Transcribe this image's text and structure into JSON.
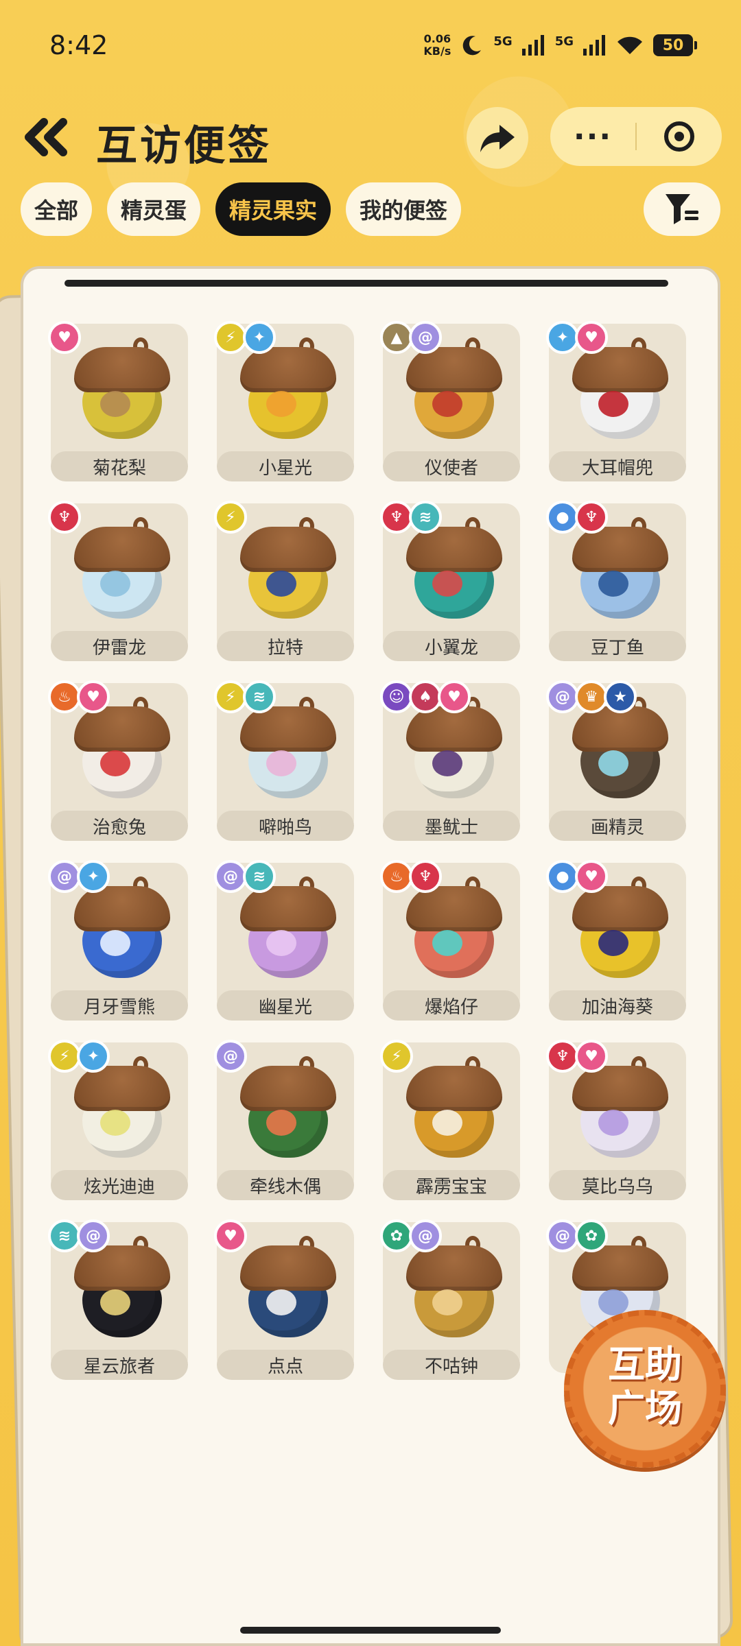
{
  "status": {
    "time": "8:42",
    "net_speed_value": "0.06",
    "net_speed_unit": "KB/s",
    "signal1": "5G",
    "signal2": "5G",
    "battery": "50"
  },
  "header": {
    "title": "互访便签",
    "more_label": "···"
  },
  "tabs": [
    {
      "label": "全部",
      "active": false
    },
    {
      "label": "精灵蛋",
      "active": false
    },
    {
      "label": "精灵果实",
      "active": true
    },
    {
      "label": "我的便签",
      "active": false
    }
  ],
  "items": [
    {
      "name": "菊花梨",
      "body": "#d8c13a",
      "spot": "#b58b52",
      "badges": [
        [
          "heart-icon",
          "#e8578a",
          "♥"
        ]
      ]
    },
    {
      "name": "小星光",
      "body": "#e6c22d",
      "spot": "#f0a030",
      "badges": [
        [
          "bolt-icon",
          "#e0c62c",
          "⚡"
        ],
        [
          "flake-icon",
          "#4aa6e3",
          "✦"
        ]
      ]
    },
    {
      "name": "仪使者",
      "body": "#e0a83a",
      "spot": "#c23a2c",
      "badges": [
        [
          "mountain-icon",
          "#9a8557",
          "▲"
        ],
        [
          "spiral-icon",
          "#9f8fe0",
          "@"
        ]
      ]
    },
    {
      "name": "大耳帽兜",
      "body": "#f1f1f1",
      "spot": "#c0202a",
      "badges": [
        [
          "flake-icon",
          "#4aa6e3",
          "✦"
        ],
        [
          "heart-icon",
          "#e8578a",
          "♥"
        ]
      ]
    },
    {
      "name": "伊雷龙",
      "body": "#cde6f2",
      "spot": "#8fc2df",
      "badges": [
        [
          "dragon-icon",
          "#d8354b",
          "♆"
        ]
      ]
    },
    {
      "name": "拉特",
      "body": "#e8c43a",
      "spot": "#2c4a9a",
      "badges": [
        [
          "bolt-icon",
          "#e0c62c",
          "⚡"
        ]
      ]
    },
    {
      "name": "小翼龙",
      "body": "#2fa69a",
      "spot": "#d84a4a",
      "badges": [
        [
          "dragon-icon",
          "#d8354b",
          "♆"
        ],
        [
          "wing-icon",
          "#47b7b9",
          "≋"
        ]
      ]
    },
    {
      "name": "豆丁鱼",
      "body": "#9cc0e6",
      "spot": "#2c5a9a",
      "badges": [
        [
          "drop-icon",
          "#4a8fe0",
          "●"
        ],
        [
          "dragon-icon",
          "#d8354b",
          "♆"
        ]
      ]
    },
    {
      "name": "治愈兔",
      "body": "#f2ede6",
      "spot": "#d8373a",
      "badges": [
        [
          "fire-icon",
          "#e86a2a",
          "♨"
        ],
        [
          "heart-icon",
          "#e8578a",
          "♥"
        ]
      ]
    },
    {
      "name": "噼啪鸟",
      "body": "#d4e6ec",
      "spot": "#e9b4d8",
      "badges": [
        [
          "bolt-icon",
          "#e0c62c",
          "⚡"
        ],
        [
          "wing-icon",
          "#47b7b9",
          "≋"
        ]
      ]
    },
    {
      "name": "墨鱿士",
      "body": "#efebdc",
      "spot": "#5a3a7a",
      "badges": [
        [
          "ghost-icon",
          "#7a4ac0",
          "☺"
        ],
        [
          "demon-icon",
          "#c43a5a",
          "♠"
        ],
        [
          "heart-icon",
          "#e8578a",
          "♥"
        ]
      ]
    },
    {
      "name": "画精灵",
      "body": "#5a4a3a",
      "spot": "#8fd8e8",
      "badges": [
        [
          "spiral-icon",
          "#9f8fe0",
          "@"
        ],
        [
          "crown-icon",
          "#e08a2a",
          "♛"
        ],
        [
          "star-icon",
          "#2c5aa8",
          "★"
        ]
      ]
    },
    {
      "name": "月牙雪熊",
      "body": "#3a6ad0",
      "spot": "#e6f0ff",
      "badges": [
        [
          "spiral-icon",
          "#9f8fe0",
          "@"
        ],
        [
          "flake-icon",
          "#4aa6e3",
          "✦"
        ]
      ]
    },
    {
      "name": "幽星光",
      "body": "#c89ae0",
      "spot": "#e9c6f3",
      "badges": [
        [
          "spiral-icon",
          "#9f8fe0",
          "@"
        ],
        [
          "wing-icon",
          "#47b7b9",
          "≋"
        ]
      ]
    },
    {
      "name": "爆焰仔",
      "body": "#e0705a",
      "spot": "#52d0c8",
      "badges": [
        [
          "fire-icon",
          "#e86a2a",
          "♨"
        ],
        [
          "dragon-icon",
          "#d8354b",
          "♆"
        ]
      ]
    },
    {
      "name": "加油海葵",
      "body": "#e8c22a",
      "spot": "#2a2a7a",
      "badges": [
        [
          "drop-icon",
          "#4a8fe0",
          "●"
        ],
        [
          "heart-icon",
          "#e8578a",
          "♥"
        ]
      ]
    },
    {
      "name": "炫光迪迪",
      "body": "#f2efe2",
      "spot": "#e6e07a",
      "badges": [
        [
          "bolt-icon",
          "#e0c62c",
          "⚡"
        ],
        [
          "flake-icon",
          "#4aa6e3",
          "✦"
        ]
      ]
    },
    {
      "name": "牵线木偶",
      "body": "#3a7a3a",
      "spot": "#e8764a",
      "badges": [
        [
          "spiral-icon",
          "#9f8fe0",
          "@"
        ]
      ]
    },
    {
      "name": "霹雳宝宝",
      "body": "#d89a2a",
      "spot": "#f6efe0",
      "badges": [
        [
          "bolt-icon",
          "#e0c62c",
          "⚡"
        ]
      ]
    },
    {
      "name": "莫比乌乌",
      "body": "#e8e2f0",
      "spot": "#b49ae0",
      "badges": [
        [
          "dragon-icon",
          "#d8354b",
          "♆"
        ],
        [
          "heart-icon",
          "#e8578a",
          "♥"
        ]
      ]
    },
    {
      "name": "星云旅者",
      "body": "#1e1e24",
      "spot": "#e8d27a",
      "badges": [
        [
          "wing-icon",
          "#47b7b9",
          "≋"
        ],
        [
          "spiral-icon",
          "#9f8fe0",
          "@"
        ]
      ]
    },
    {
      "name": "点点",
      "body": "#2a4a7a",
      "spot": "#f2f2f2",
      "badges": [
        [
          "heart-icon",
          "#e8578a",
          "♥"
        ]
      ]
    },
    {
      "name": "不咕钟",
      "body": "#c99a3a",
      "spot": "#f0d090",
      "badges": [
        [
          "gear-icon",
          "#2fa67a",
          "✿"
        ],
        [
          "spiral-icon",
          "#9f8fe0",
          "@"
        ]
      ]
    },
    {
      "name": "",
      "body": "#dfe4f0",
      "spot": "#8fa0d8",
      "badges": [
        [
          "spiral-icon",
          "#9f8fe0",
          "@"
        ],
        [
          "gear-icon",
          "#2fa67a",
          "✿"
        ]
      ]
    }
  ],
  "plaza": {
    "line1": "互助",
    "line2": "广场"
  }
}
